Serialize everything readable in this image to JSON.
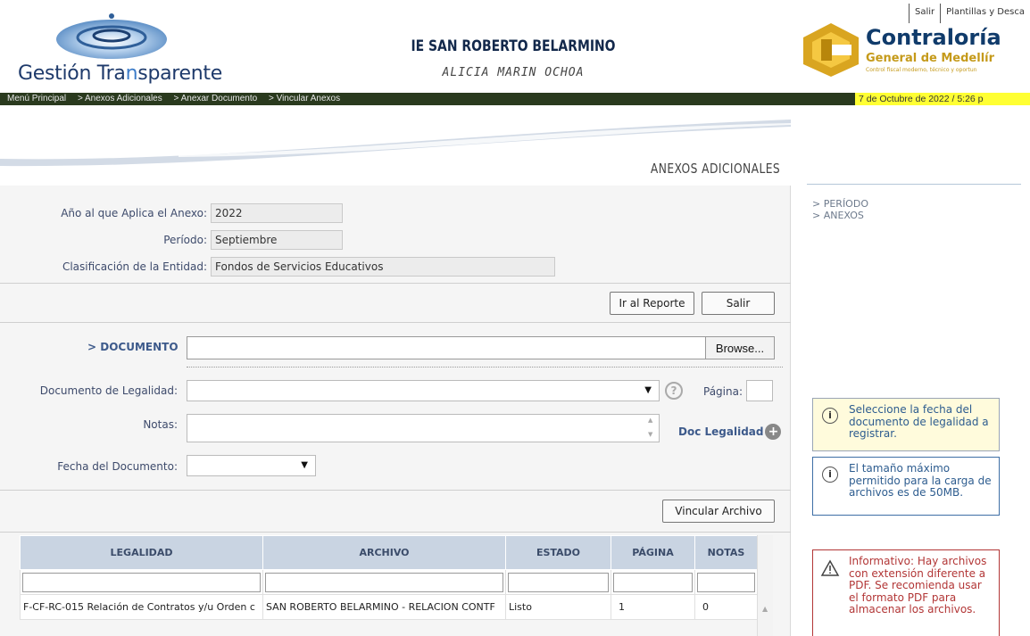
{
  "header": {
    "brand_part1": "Gestión Tra",
    "brand_part2": "n",
    "brand_part3": "sparente",
    "entity": "IE SAN ROBERTO BELARMINO",
    "user": "ALICIA MARIN OCHOA",
    "top_links": [
      "Salir",
      "Plantillas y Desca"
    ],
    "contraloria_title": "Contraloría",
    "contraloria_sub": "General de Medellír",
    "contraloria_tag": "Control fiscal moderno, técnico y oportun"
  },
  "nav": {
    "breadcrumbs": [
      "Menú Principal",
      "> Anexos Adicionales",
      "> Anexar Documento",
      "> Vincular Anexos"
    ],
    "date": "7 de Octubre de 2022 / 5:26 p"
  },
  "main": {
    "section_title": "ANEXOS ADICIONALES",
    "fields": {
      "anio_label": "Año al que Aplica el Anexo:",
      "anio_value": "2022",
      "periodo_label": "Período:",
      "periodo_value": "Septiembre",
      "clasif_label": "Clasificación de la Entidad:",
      "clasif_value": "Fondos de Servicios Educativos"
    },
    "buttons": {
      "ir_reporte": "Ir al Reporte",
      "salir": "Salir",
      "browse": "Browse...",
      "vincular": "Vincular Archivo"
    },
    "documento_label": "> DOCUMENTO",
    "doc_legalidad_label": "Documento de Legalidad:",
    "pagina_label": "Página:",
    "notas_label": "Notas:",
    "doc_legalidad_link": "Doc Legalidad",
    "fecha_label": "Fecha del Documento:",
    "help_glyph": "?"
  },
  "table": {
    "headers": [
      "LEGALIDAD",
      "ARCHIVO",
      "ESTADO",
      "PÁGINA",
      "NOTAS"
    ],
    "rows": [
      [
        "F-CF-RC-015 Relación de Contratos y/u Orden c",
        "SAN ROBERTO BELARMINO - RELACION CONTF",
        "Listo",
        "1",
        "0"
      ]
    ]
  },
  "sidebar": {
    "nav": [
      "> PERÍODO",
      "> ANEXOS"
    ],
    "info1": "Seleccione la fecha del documento de legalidad a registrar.",
    "info2": "El tamaño máximo permitido para la carga de archivos es de 50MB.",
    "info3": "Informativo: Hay archivos con extensión diferente a PDF. Se recomienda usar el formato PDF para almacenar los archivos."
  },
  "colors": {
    "navbar": "#2a3a1e",
    "date_highlight": "#ffff33",
    "table_header": "#c9d4e2",
    "brand_blue": "#1e3a6b",
    "gold": "#c59a1a"
  }
}
